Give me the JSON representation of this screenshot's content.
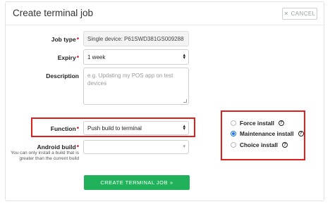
{
  "header": {
    "title": "Create terminal job",
    "cancel_label": "CANCEL",
    "cancel_icon": "close-icon"
  },
  "form": {
    "job_type": {
      "label": "Job type",
      "value": "Single device: P61SWD381GS009288"
    },
    "expiry": {
      "label": "Expiry",
      "value": "1 week"
    },
    "description": {
      "label": "Description",
      "placeholder": "e.g. Updating my POS app on test devices"
    },
    "function": {
      "label": "Function",
      "value": "Push build to terminal"
    },
    "android_build": {
      "label": "Android build",
      "hint": "You can only install a build that is greater than the current build",
      "value": ""
    },
    "required_marker": "*"
  },
  "install_options": [
    {
      "label": "Force install",
      "selected": false
    },
    {
      "label": "Maintenance install",
      "selected": true
    },
    {
      "label": "Choice install",
      "selected": false
    }
  ],
  "help_glyph": "?",
  "submit": {
    "label": "CREATE TERMINAL JOB",
    "arrow": "»"
  },
  "colors": {
    "highlight": "#e01e1e",
    "submit_bg": "#21b15a",
    "required": "#d0021b",
    "radio_selected": "#1a73e8"
  }
}
